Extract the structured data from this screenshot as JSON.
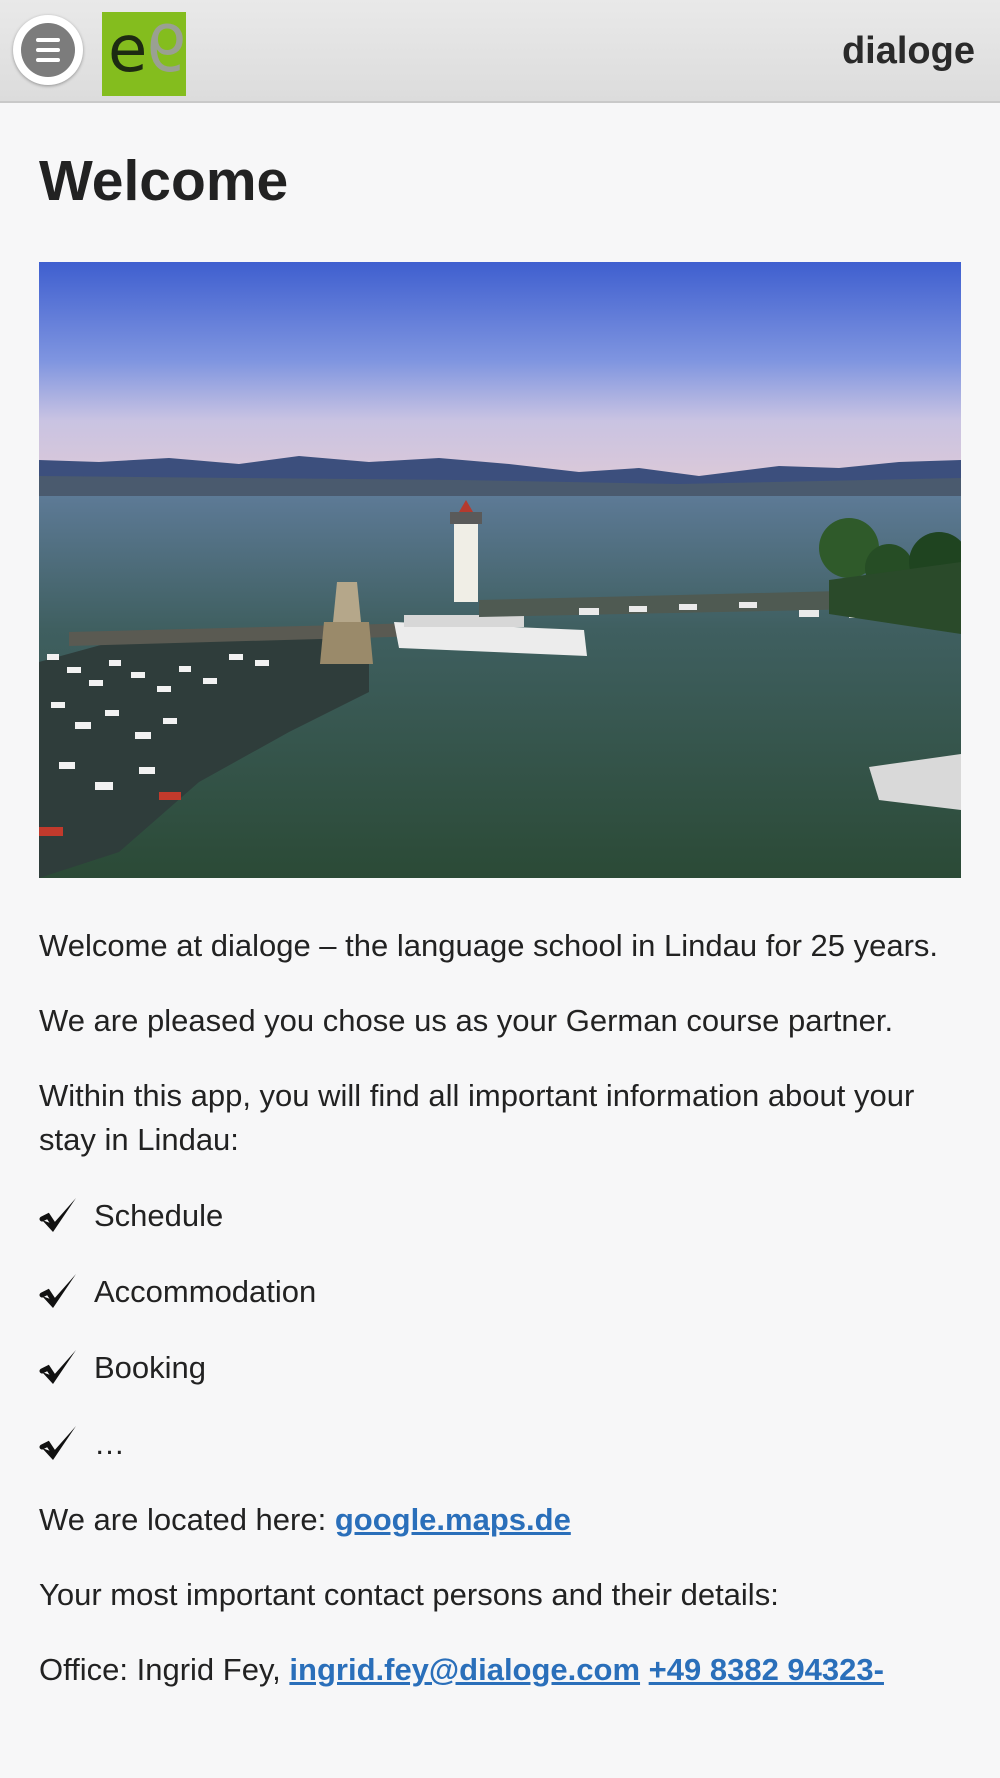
{
  "header": {
    "brand": "dialoge",
    "logo_letters": [
      "e",
      "9"
    ]
  },
  "main": {
    "title": "Welcome",
    "intro": "Welcome at dialoge – the language school in Lindau for 25 years.",
    "pleased": "We are pleased you chose us as your German course partner.",
    "within": "Within this app, you will find all important information about your stay in Lindau:",
    "checklist": [
      "Schedule",
      "Accommodation",
      "Booking",
      "…"
    ],
    "location_prefix": "We are located here: ",
    "location_link": "google.maps.de",
    "contacts_intro": "Your most important contact persons and their details:",
    "office_prefix": "Office: Ingrid Fey, ",
    "office_email": "ingrid.fey@dialoge.com",
    "office_phone": "+49 8382 94323-"
  },
  "colors": {
    "accent_link": "#2a6fba",
    "logo_green": "#84bd1e",
    "header_bg": "#e3e3e3"
  },
  "icons": [
    "menu-icon",
    "checkmark-icon"
  ]
}
